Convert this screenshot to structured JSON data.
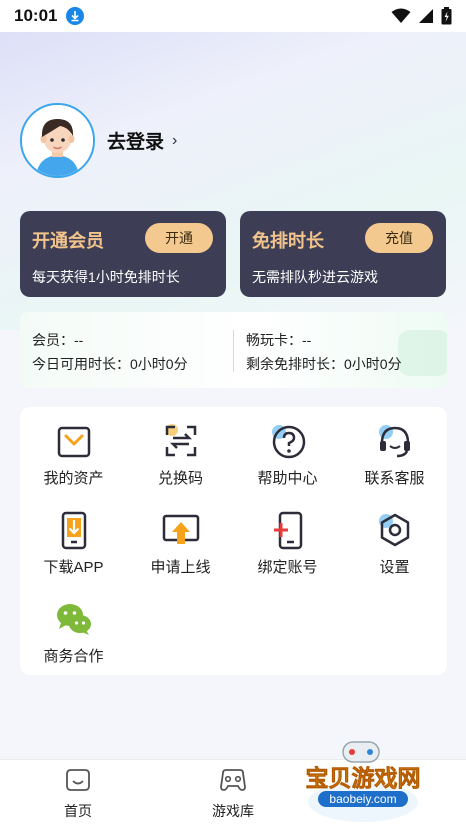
{
  "status_bar": {
    "time": "10:01",
    "icons": [
      "download-badge-icon",
      "wifi-icon",
      "signal-icon",
      "battery-icon"
    ]
  },
  "profile": {
    "login_label": "去登录",
    "chevron": "›"
  },
  "vip_card": {
    "title": "开通会员",
    "button": "开通",
    "desc": "每天获得1小时免排时长"
  },
  "time_card": {
    "title": "免排时长",
    "button": "充值",
    "desc": "无需排队秒进云游戏"
  },
  "info": {
    "member": "会员：--",
    "today_available": "今日可用时长：0小时0分",
    "play_card": "畅玩卡：--",
    "remaining": "剩余免排时长：0小时0分"
  },
  "grid": [
    {
      "label": "我的资产",
      "icon": "wallet-icon"
    },
    {
      "label": "兑换码",
      "icon": "exchange-scan-icon"
    },
    {
      "label": "帮助中心",
      "icon": "help-icon"
    },
    {
      "label": "联系客服",
      "icon": "headset-icon"
    },
    {
      "label": "下载APP",
      "icon": "phone-download-icon"
    },
    {
      "label": "申请上线",
      "icon": "upload-screen-icon"
    },
    {
      "label": "绑定账号",
      "icon": "phone-add-icon"
    },
    {
      "label": "设置",
      "icon": "settings-icon"
    },
    {
      "label": "商务合作",
      "icon": "wechat-icon"
    }
  ],
  "tabs": [
    {
      "label": "首页",
      "icon": "home-smile-icon"
    },
    {
      "label": "游戏库",
      "icon": "gamepad-icon"
    }
  ],
  "watermark": {
    "title": "宝贝游戏网",
    "url": "baobeiy.com"
  },
  "colors": {
    "card_bg": "#3d3e55",
    "card_title": "#f2c48c",
    "card_button": "#f3c98f",
    "icon_dark": "#2d2d3a",
    "icon_accent_orange": "#f7a21b",
    "icon_accent_blue": "#7bc2f3",
    "icon_accent_red": "#e83b3b",
    "wechat_green": "#7fb93a"
  }
}
